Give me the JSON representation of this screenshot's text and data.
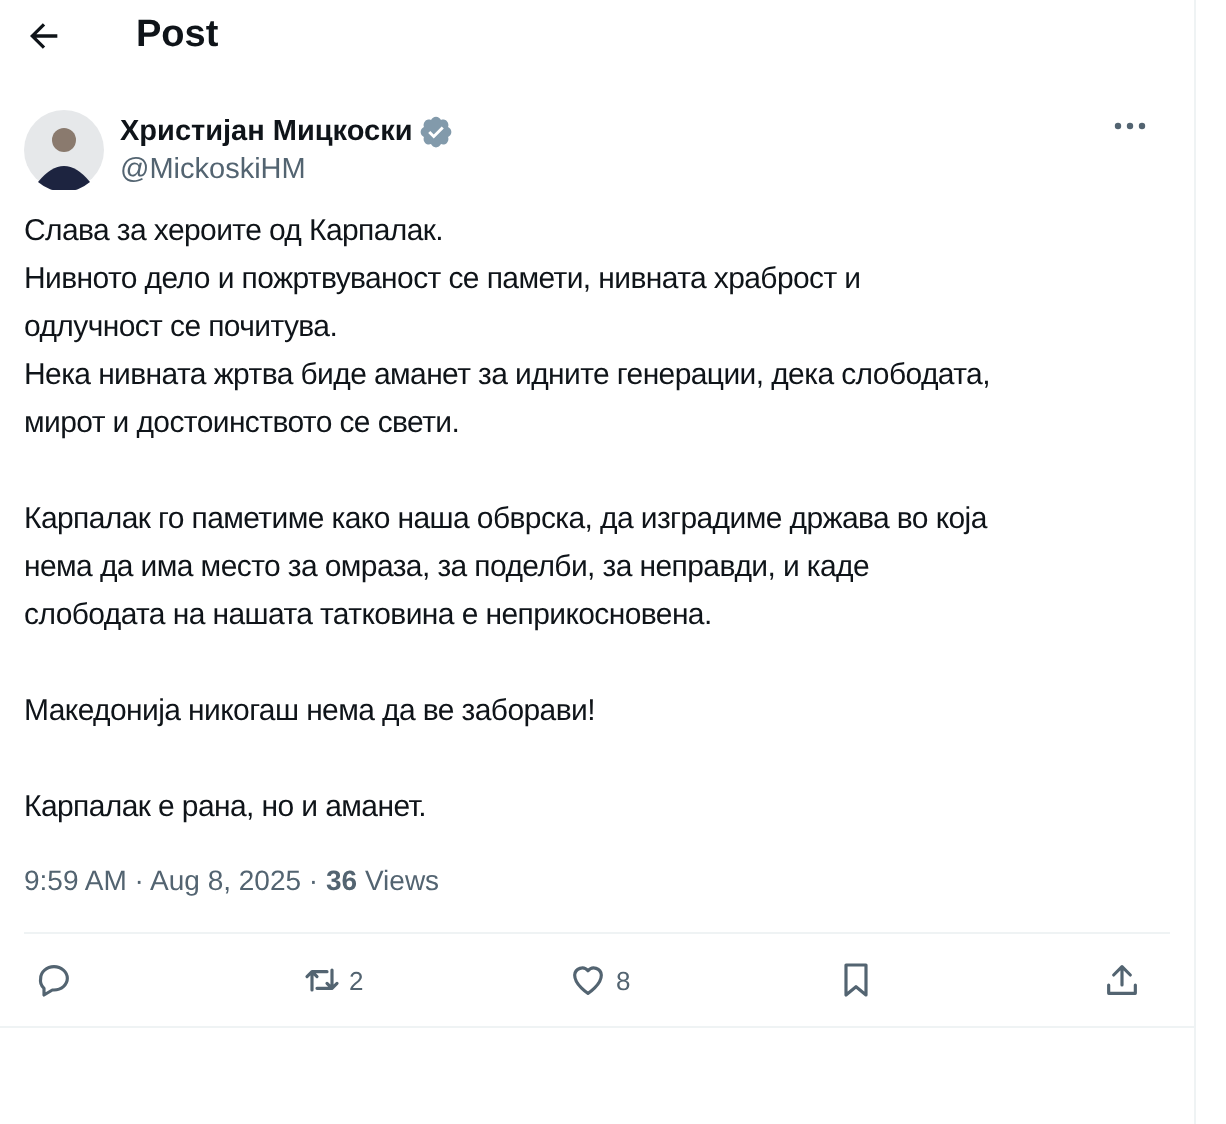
{
  "header": {
    "title": "Post"
  },
  "author": {
    "name": "Христијан Мицкоски",
    "handle": "@MickoskiHM",
    "verified": true
  },
  "paragraphs": [
    [
      "Слава за хероите од Карпалак.",
      "Нивното дело и пожртвуваност се памети, нивната храброст и",
      "одлучност се почитува.",
      "Нека нивната жртва биде аманет за идните генерации, дека слободата,",
      "мирот и достоинството се свети."
    ],
    [
      "Карпалак го паметиме како наша обврска, да изградиме држава во која",
      "нема да има место за омраза, за поделби, за неправди, и каде",
      "слободата на нашата татковина е неприкосновена."
    ],
    [
      "Македонија никогаш нема да ве заборави!"
    ],
    [
      "Карпалак е рана, но и аманет."
    ]
  ],
  "meta": "9:59 AM · Aug 8, 2025 · **36** Views",
  "actions": [
    {
      "kind": "reply"
    },
    {
      "kind": "repost",
      "count": "2"
    },
    {
      "kind": "like",
      "count": "8"
    },
    {
      "kind": "bookmark"
    },
    {
      "kind": "share"
    }
  ]
}
